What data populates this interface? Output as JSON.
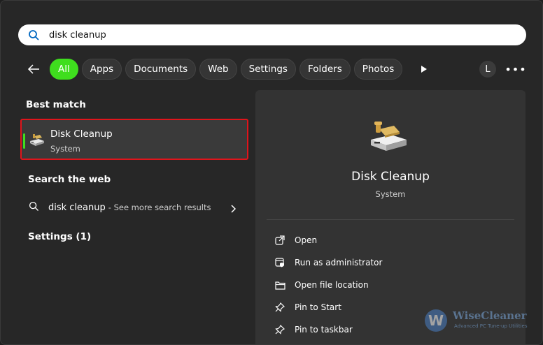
{
  "search": {
    "value": "disk cleanup"
  },
  "filters": [
    "All",
    "Apps",
    "Documents",
    "Web",
    "Settings",
    "Folders",
    "Photos"
  ],
  "account_initial": "L",
  "more_label": "•••",
  "sections": {
    "best_match": "Best match",
    "search_web": "Search the web",
    "settings": "Settings (1)"
  },
  "best_match": {
    "title": "Disk Cleanup",
    "subtitle": "System"
  },
  "web_result": {
    "query": "disk cleanup",
    "suffix": "- See more search results"
  },
  "detail": {
    "title": "Disk Cleanup",
    "subtitle": "System",
    "actions": [
      "Open",
      "Run as administrator",
      "Open file location",
      "Pin to Start",
      "Pin to taskbar"
    ]
  },
  "watermark": {
    "brand": "WiseCleaner",
    "tagline": "Advanced PC Tune-up Utilities",
    "logo_letter": "W"
  },
  "colors": {
    "accent": "#3fde1e",
    "highlight_border": "#e0141b",
    "background": "#272727",
    "panel": "#333333"
  },
  "icons": [
    "search-icon",
    "back-arrow-icon",
    "play-icon",
    "disk-cleanup-icon",
    "chevron-right-icon",
    "open-icon",
    "run-as-admin-icon",
    "folder-icon",
    "pin-icon"
  ]
}
